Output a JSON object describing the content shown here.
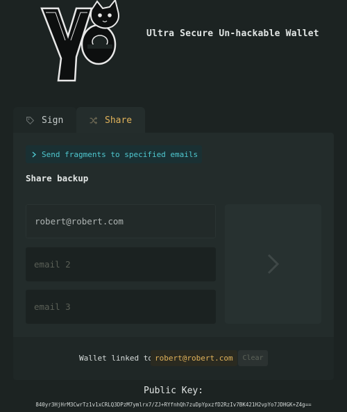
{
  "header": {
    "logo_text": "ye",
    "title": "Ultra Secure Un-hackable Wallet"
  },
  "tabs": [
    {
      "label": "Sign",
      "icon": "tag-icon",
      "active": false
    },
    {
      "label": "Share",
      "icon": "shuffle-icon",
      "active": true
    }
  ],
  "share": {
    "info": "Send fragments to specified emails",
    "section_title": "Share backup",
    "fields": [
      {
        "value": "robert@robert.com",
        "placeholder": ""
      },
      {
        "value": "",
        "placeholder": "email 2"
      },
      {
        "value": "",
        "placeholder": "email 3"
      }
    ],
    "submit_icon": "chevron-right-icon"
  },
  "footer": {
    "linked_label": "Wallet linked to",
    "linked_email": "robert@robert.com",
    "clear_label": "Clear"
  },
  "public_key": {
    "label": "Public Key:",
    "value": "840yr3HjHrM3CwrTz1v1xCRLQ3DPzM7ymlrx7/ZJ+RYfnhQh7zuDpYpxzfD2RzIv7BK421H2vpYo7JDHGK+Z4g=="
  },
  "colors": {
    "background": "#1c2322",
    "panel": "#232c2b",
    "accent": "#e0b25a",
    "info": "#4fc8d0"
  }
}
